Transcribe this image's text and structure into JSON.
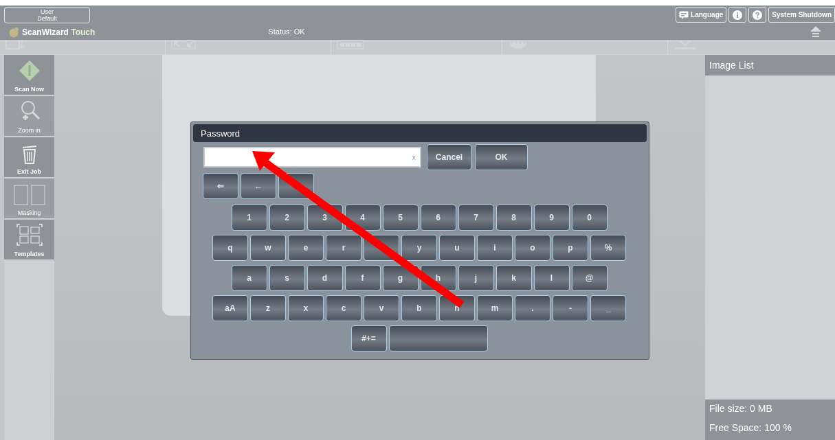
{
  "header": {
    "user_button": {
      "lines": [
        "User",
        "Default"
      ]
    },
    "top_buttons": [
      {
        "kind": "language",
        "label": "Language"
      },
      {
        "kind": "info"
      },
      {
        "kind": "help"
      },
      {
        "kind": "text",
        "label": "System Shutdown"
      }
    ],
    "brand": "ScanWizard",
    "brand_suffix": "Touch",
    "status": "Status: OK"
  },
  "sidebar": {
    "items": [
      {
        "kind": "scan",
        "label": "Scan Now",
        "disabled": false
      },
      {
        "kind": "zoom",
        "label": "Zoom in",
        "disabled": true
      },
      {
        "kind": "trash",
        "label": "Exit Job",
        "disabled": false
      },
      {
        "kind": "masking",
        "label": "Masking",
        "disabled": true
      },
      {
        "kind": "templates",
        "label": "Templates",
        "disabled": false
      }
    ]
  },
  "image_list": {
    "title": "Image List",
    "file_size": "File size: 0 MB",
    "free_space": "Free Space: 100 %"
  },
  "dialog": {
    "title": "Password",
    "clear": "x",
    "buttons": [
      "Cancel",
      "OK"
    ],
    "nav_keys": [
      {
        "label": "⇐"
      },
      {
        "label": "←"
      },
      {
        "kind": "covered"
      }
    ],
    "rows": [
      [
        {
          "label": "1"
        },
        {
          "label": "2"
        },
        {
          "label": "3"
        },
        {
          "label": "4"
        },
        {
          "label": "5"
        },
        {
          "label": "6"
        },
        {
          "label": "7"
        },
        {
          "label": "8"
        },
        {
          "label": "9"
        },
        {
          "label": "0"
        }
      ],
      [
        {
          "label": "q"
        },
        {
          "label": "w"
        },
        {
          "label": "e"
        },
        {
          "label": "r"
        },
        {
          "kind": "covered"
        },
        {
          "label": "y"
        },
        {
          "label": "u"
        },
        {
          "label": "i"
        },
        {
          "label": "o"
        },
        {
          "label": "p"
        },
        {
          "label": "%"
        }
      ],
      [
        {
          "label": "a"
        },
        {
          "label": "s"
        },
        {
          "label": "d"
        },
        {
          "label": "f"
        },
        {
          "label": "g"
        },
        {
          "label": "h"
        },
        {
          "label": "j"
        },
        {
          "label": "k"
        },
        {
          "label": "l"
        },
        {
          "label": "@"
        }
      ],
      [
        {
          "label": "aA"
        },
        {
          "label": "z"
        },
        {
          "label": "x"
        },
        {
          "label": "c"
        },
        {
          "label": "v"
        },
        {
          "label": "b"
        },
        {
          "label": "n"
        },
        {
          "label": "m"
        },
        {
          "label": "."
        },
        {
          "label": "-"
        },
        {
          "label": "_"
        }
      ],
      [
        {
          "label": "#+="
        },
        {
          "kind": "space"
        }
      ]
    ]
  }
}
